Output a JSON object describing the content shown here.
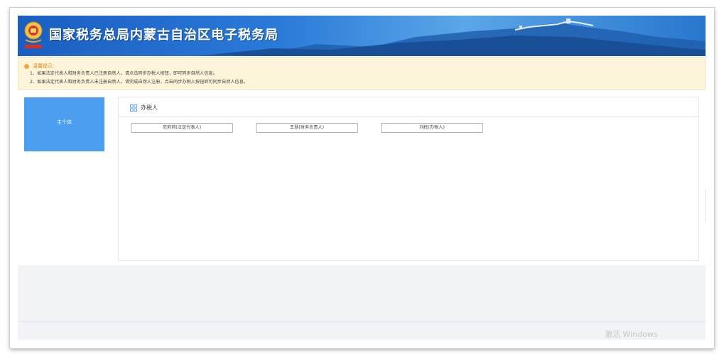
{
  "header": {
    "title": "国家税务总局内蒙古自治区电子税务局",
    "emblem_icon": "tax-emblem-icon"
  },
  "notice": {
    "title": "温馨提示：",
    "lines": [
      "1、如果法定代表人和财务负责人已注册自然人，请点击同步办税人按钮，即可同步自然人信息。",
      "2、如果法定代表人和财务负责人未注册自然人，请完成自然人注册，点击同步办税人按钮即可同步自然人信息。"
    ]
  },
  "sidebar": {
    "items": [
      {
        "label": "主个体"
      }
    ]
  },
  "panel": {
    "title": "办税人",
    "title_icon": "grid-icon",
    "persons": [
      {
        "label": "范莉莉(法定代表人)"
      },
      {
        "label": "王慧(财务负责人)"
      },
      {
        "label": "刘栋(办税人)"
      }
    ]
  },
  "watermark": {
    "text": "激活 Windows"
  },
  "colors": {
    "banner_blue": "#1a5ec2",
    "sidebar_active": "#4c9ef0",
    "notice_bg": "#fdf5d9",
    "notice_title": "#e08a2a"
  }
}
